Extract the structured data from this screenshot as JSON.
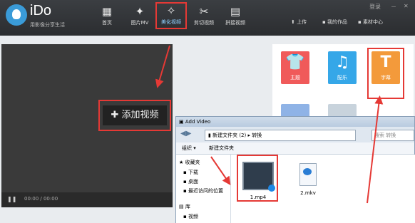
{
  "app": {
    "brand": "iDo",
    "tagline": "用影像分享生活",
    "nav": [
      {
        "label": "首页",
        "icon": "grid-icon"
      },
      {
        "label": "图片MV",
        "icon": "figure-icon"
      },
      {
        "label": "美化视频",
        "icon": "magic-wand-icon",
        "active": true
      },
      {
        "label": "剪切视频",
        "icon": "scissors-icon"
      },
      {
        "label": "拼接视频",
        "icon": "film-icon"
      }
    ],
    "right_nav": [
      "上传",
      "我的作品",
      "素材中心"
    ],
    "window_controls": [
      "登录",
      "－",
      "✕"
    ],
    "accent_colors": {
      "tile_red": "#f05a5a",
      "tile_blue": "#35a7e8",
      "tile_orange": "#f39a3b",
      "highlight": "#e53935"
    }
  },
  "player": {
    "add_video_label": "添加视频",
    "time": "00:00 / 00:00"
  },
  "panel": {
    "tiles": [
      {
        "label": "主题",
        "glyph": "👕"
      },
      {
        "label": "配乐",
        "glyph": "♫"
      },
      {
        "label": "字幕",
        "glyph": "T"
      }
    ]
  },
  "dialog": {
    "title": "Add Video",
    "address": [
      "新建文件夹 (2)",
      "转换"
    ],
    "search_placeholder": "搜索 转换",
    "toolbar": [
      "组织 ▾",
      "新建文件夹"
    ],
    "tree": [
      "收藏夹",
      "下载",
      "桌面",
      "最近访问的位置",
      "库",
      "视频"
    ],
    "files": [
      "1.mp4",
      "2.mkv"
    ]
  }
}
